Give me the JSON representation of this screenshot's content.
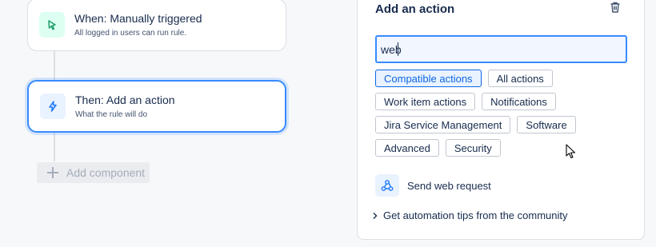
{
  "flow": {
    "trigger": {
      "title": "When: Manually triggered",
      "subtitle": "All logged in users can run rule.",
      "icon": "cursor-click-icon"
    },
    "action": {
      "title": "Then: Add an action",
      "subtitle": "What the rule will do",
      "icon": "lightning-icon"
    },
    "add_component_label": "Add component"
  },
  "panel": {
    "title": "Add an action",
    "search": {
      "value": "web",
      "placeholder": ""
    },
    "chips": [
      {
        "label": "Compatible actions",
        "selected": true
      },
      {
        "label": "All actions",
        "selected": false
      },
      {
        "label": "Work item actions",
        "selected": false
      },
      {
        "label": "Notifications",
        "selected": false
      },
      {
        "label": "Jira Service Management",
        "selected": false
      },
      {
        "label": "Software",
        "selected": false
      },
      {
        "label": "Advanced",
        "selected": false
      },
      {
        "label": "Security",
        "selected": false
      }
    ],
    "result": {
      "label": "Send web request",
      "icon": "webhook-icon"
    },
    "tips_label": "Get automation tips from the community"
  },
  "colors": {
    "accent": "#0c66e4",
    "focus_border": "#388bff",
    "trigger_icon_bg": "#dcfff1",
    "action_icon_bg": "#e9f2ff"
  }
}
